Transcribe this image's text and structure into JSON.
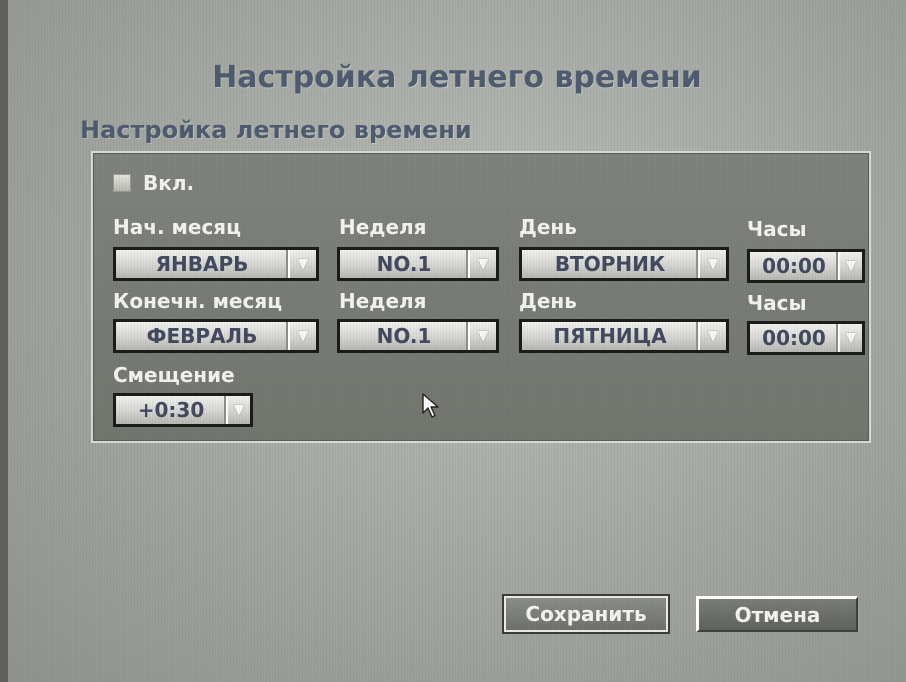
{
  "dialog": {
    "title": "Настройка летнего времени",
    "section_title": "Настройка летнего времени"
  },
  "enable": {
    "label": "Вкл.",
    "checked": false
  },
  "start": {
    "month_label": "Нач. месяц",
    "month_value": "ЯНВАРЬ",
    "week_label": "Неделя",
    "week_value": "NO.1",
    "day_label": "День",
    "day_value": "ВТОРНИК",
    "hour_label": "Часы",
    "hour_value": "00:00"
  },
  "end": {
    "month_label": "Конечн. месяц",
    "month_value": "ФЕВРАЛЬ",
    "week_label": "Неделя",
    "week_value": "NO.1",
    "day_label": "День",
    "day_value": "ПЯТНИЦА",
    "hour_label": "Часы",
    "hour_value": "00:00"
  },
  "offset": {
    "label": "Смещение",
    "value": "+0:30"
  },
  "buttons": {
    "save": "Сохранить",
    "cancel": "Отмена"
  },
  "icons": {
    "dropdown": "chevron-down-icon",
    "cursor": "mouse-pointer-icon"
  },
  "colors": {
    "title": "#4f5c70",
    "panel": "#7a7d78",
    "label": "#f2f2ee",
    "dropdown_text": "#434a60"
  }
}
